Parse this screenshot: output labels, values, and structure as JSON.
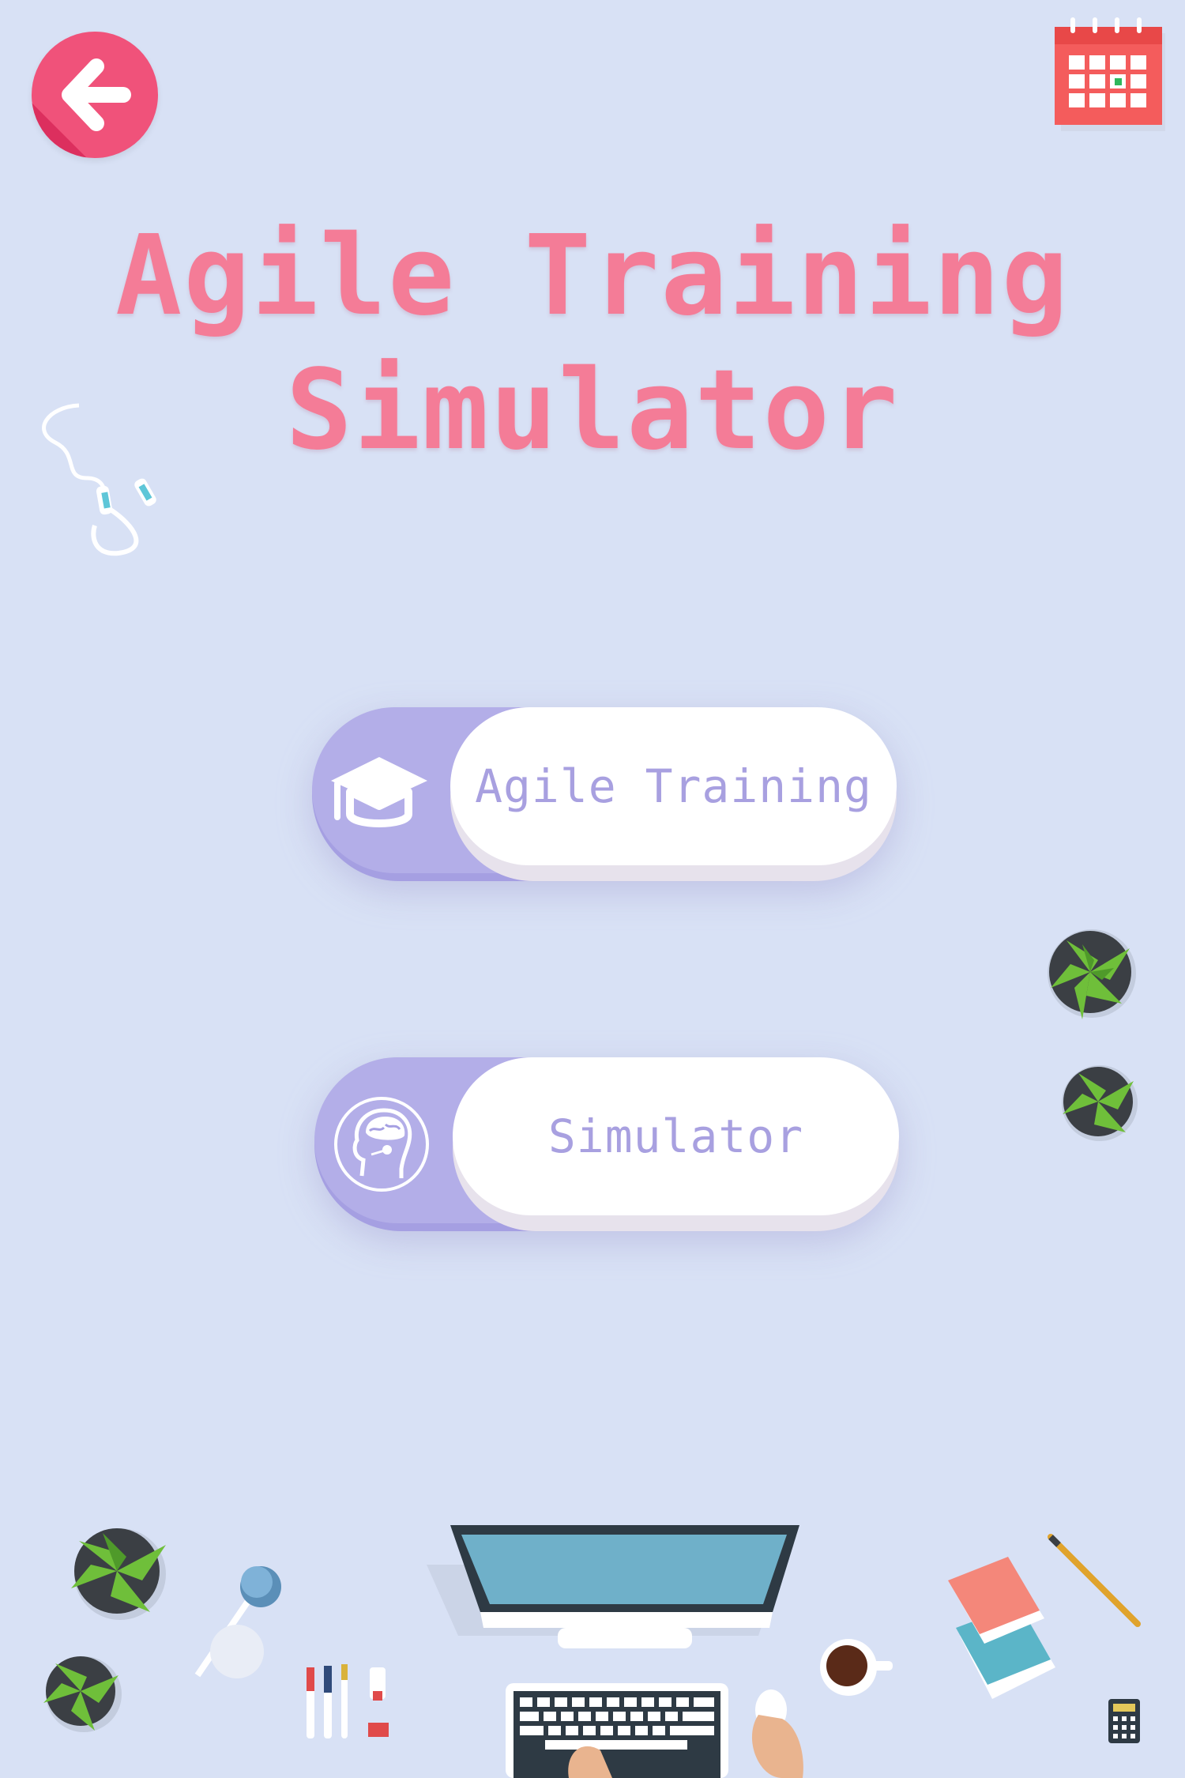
{
  "header": {
    "back_icon": "arrow-left-icon",
    "calendar_icon": "calendar-icon"
  },
  "title": {
    "line1": "Agile Training",
    "line2": "Simulator"
  },
  "menu": {
    "training": {
      "label": "Agile Training",
      "icon": "graduation-cap-icon"
    },
    "simulator": {
      "label": "Simulator",
      "icon": "head-brain-icon"
    }
  },
  "colors": {
    "background": "#d8e1f5",
    "title": "#f47c97",
    "button_accent": "#a59fe2",
    "button_text": "#a8a0e0",
    "back_button": "#f0527a",
    "calendar": "#f45c5c"
  }
}
